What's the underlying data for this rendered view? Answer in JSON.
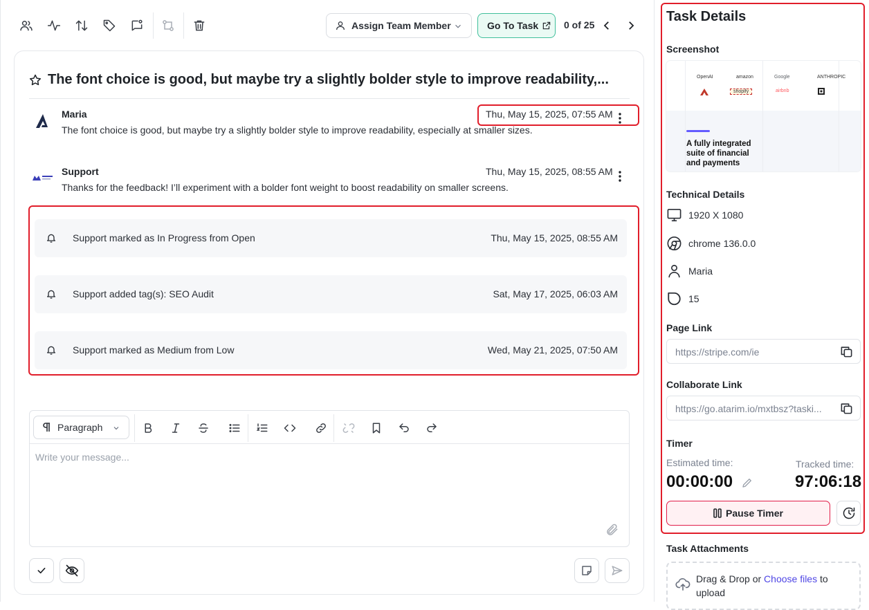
{
  "toolbar": {
    "assign_label": "Assign Team Member",
    "goto_label": "Go To Task",
    "pager_text": "0 of 25"
  },
  "task": {
    "title": "The font choice is good, but maybe try a slightly bolder style to improve readability,..."
  },
  "messages": [
    {
      "author": "Maria",
      "date": "Thu, May 15, 2025, 07:55 AM",
      "text": "The font choice is good, but maybe try a slightly bolder style to improve readability, especially at smaller sizes."
    },
    {
      "author": "Support",
      "date": "Thu, May 15, 2025, 08:55 AM",
      "text": "Thanks for the feedback! I’ll experiment with a bolder font weight to boost readability on smaller screens."
    }
  ],
  "activity": [
    {
      "text": "Support marked as In Progress from Open",
      "date": "Thu, May 15, 2025, 08:55 AM"
    },
    {
      "text": "Support added tag(s): SEO Audit",
      "date": "Sat, May 17, 2025, 06:03 AM"
    },
    {
      "text": "Support marked as Medium from Low",
      "date": "Wed, May 21, 2025, 07:50 AM"
    }
  ],
  "editor": {
    "block_type": "Paragraph",
    "placeholder": "Write your message..."
  },
  "details": {
    "title": "Task Details",
    "screenshot_label": "Screenshot",
    "screenshot_logos": [
      "OpenAI",
      "amazon",
      "Google",
      "ANTHROPIC",
      "shopify",
      "airbnb"
    ],
    "screenshot_headline": "A fully integrated suite of financial and payments",
    "technical_label": "Technical Details",
    "resolution": "1920 X 1080",
    "browser": "chrome 136.0.0",
    "user": "Maria",
    "task_number": "15",
    "page_link_label": "Page Link",
    "page_link": "https://stripe.com/ie",
    "collab_link_label": "Collaborate Link",
    "collab_link": "https://go.atarim.io/mxtbsz?taski...",
    "timer_label": "Timer",
    "estimated_label": "Estimated time:",
    "estimated_value": "00:00:00",
    "tracked_label": "Tracked time:",
    "tracked_value": "97:06:18",
    "pause_label": "Pause Timer",
    "attachments_label": "Task Attachments",
    "dz_text_before": "Drag & Drop or ",
    "dz_link": "Choose files",
    "dz_text_after": " to upload"
  },
  "colors": {
    "highlight": "#e11d2a",
    "accent_green": "#3fbf9b",
    "link": "#4f46e5"
  }
}
